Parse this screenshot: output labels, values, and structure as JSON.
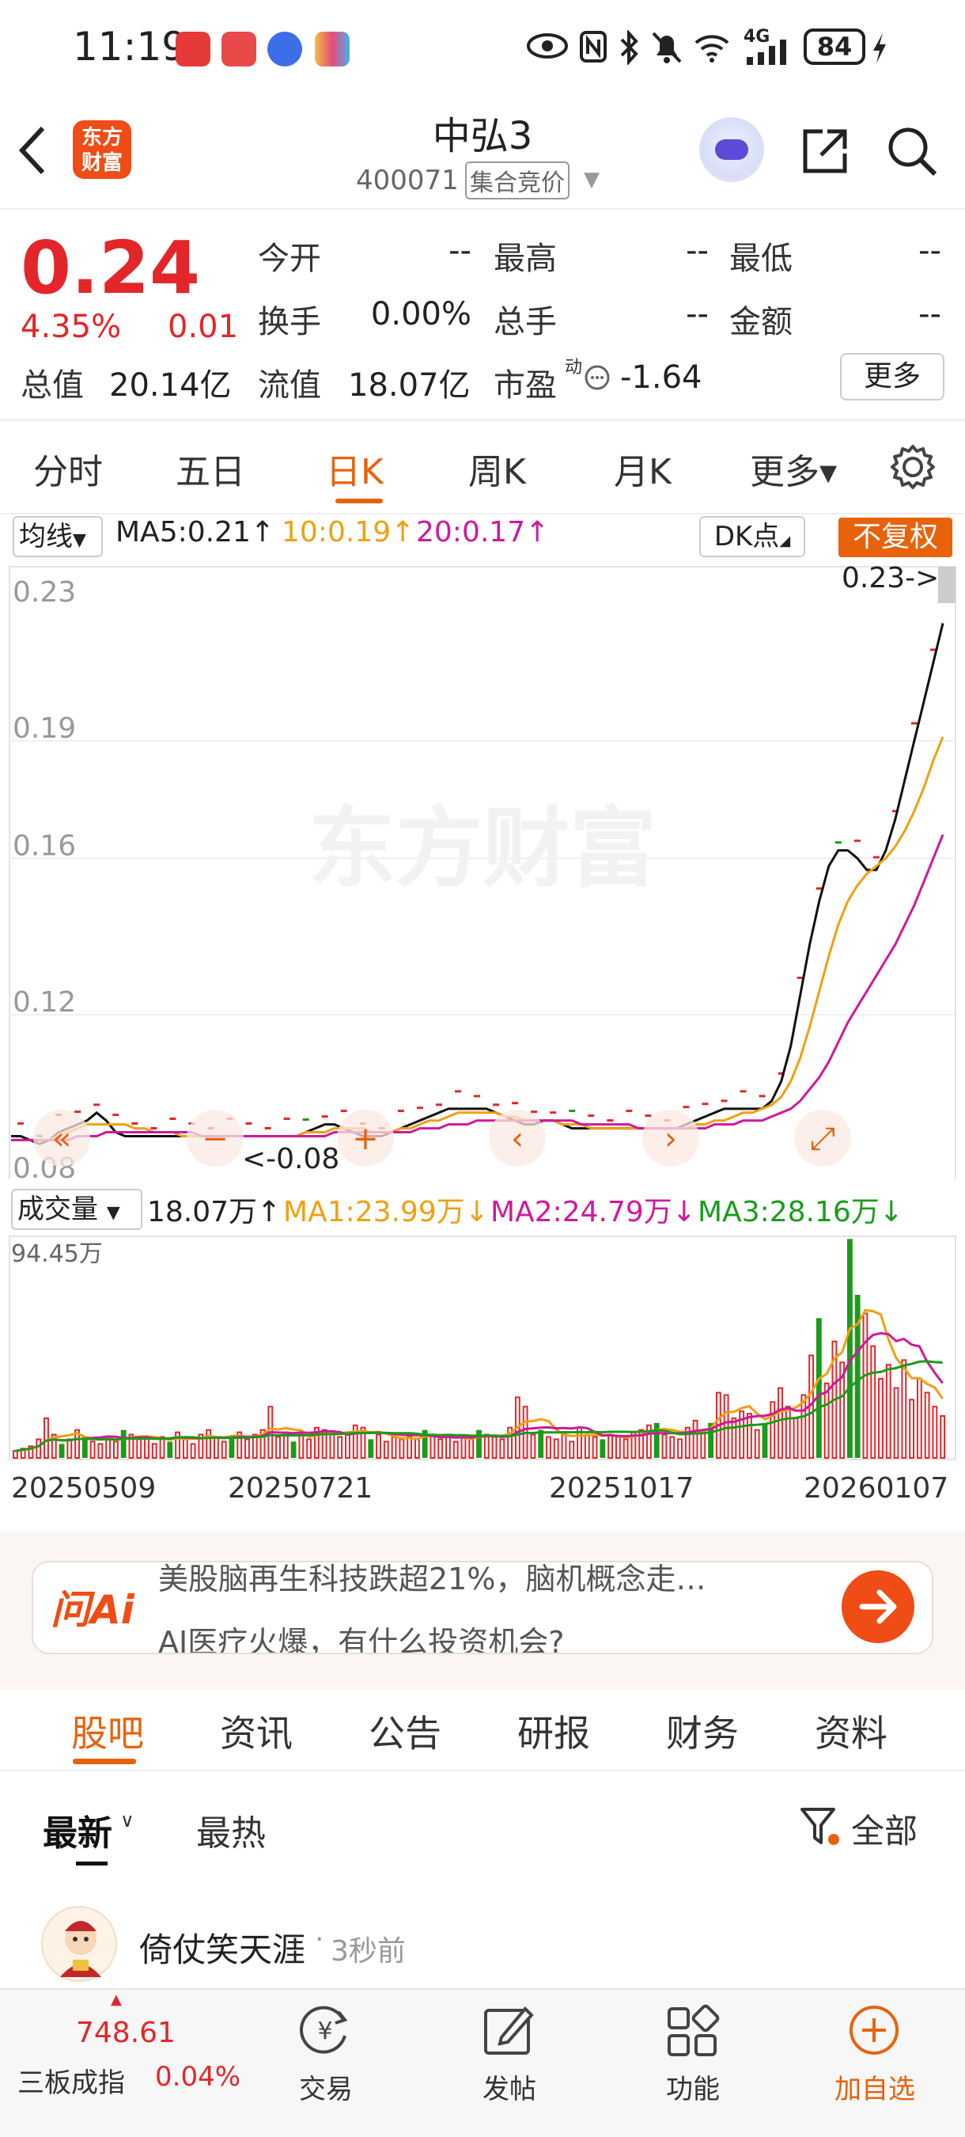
{
  "status_bar": {
    "time": "11:19",
    "network": "4G",
    "battery": "84"
  },
  "header": {
    "back_icon": "chevron-left-icon",
    "logo_text": "东方财富",
    "title": "中弘3",
    "code": "400071",
    "auction_tag": "集合竞价",
    "icons": [
      "robot-assistant-icon",
      "share-icon",
      "search-icon"
    ]
  },
  "quote": {
    "price": "0.24",
    "change_pct": "4.35%",
    "change_abs": "0.01",
    "fields": [
      {
        "label": "今开",
        "value": "--"
      },
      {
        "label": "最高",
        "value": "--"
      },
      {
        "label": "最低",
        "value": "--"
      },
      {
        "label": "换手",
        "value": "0.00%"
      },
      {
        "label": "总手",
        "value": "--"
      },
      {
        "label": "金额",
        "value": "--"
      }
    ],
    "total_value_label": "总值",
    "total_value": "20.14亿",
    "float_value_label": "流值",
    "float_value": "18.07亿",
    "pe_label": "市盈",
    "pe_superscript": "动",
    "pe_value": "-1.64",
    "more_label": "更多",
    "color_up": "#e3262a"
  },
  "period_tabs": [
    "分时",
    "五日",
    "日K",
    "周K",
    "月K",
    "更多▾"
  ],
  "period_active": "日K",
  "ma_legend": {
    "selector": "均线",
    "ma5": "MA5:0.21↑",
    "ma10": "10:0.19↑",
    "ma20": "20:0.17↑",
    "dk_button": "DK点",
    "adjust_button": "不复权",
    "colors": {
      "ma5": "#111111",
      "ma10": "#f0a010",
      "ma20": "#d0189c"
    }
  },
  "chart_data": [
    {
      "type": "line",
      "title": "",
      "y_ticks": [
        "0.23",
        "0.19",
        "0.16",
        "0.12",
        "0.08"
      ],
      "ylim": [
        0.08,
        0.23
      ],
      "watermark": "东方财富",
      "annotations": [
        "0.23->",
        "<-0.08"
      ],
      "series": [
        {
          "name": "MA5",
          "color": "#111111",
          "values": [
            0.089,
            0.089,
            0.088,
            0.087,
            0.088,
            0.09,
            0.091,
            0.092,
            0.093,
            0.095,
            0.093,
            0.09,
            0.089,
            0.089,
            0.089,
            0.089,
            0.089,
            0.089,
            0.089,
            0.089,
            0.089,
            0.089,
            0.089,
            0.089,
            0.089,
            0.089,
            0.089,
            0.089,
            0.089,
            0.089,
            0.089,
            0.09,
            0.091,
            0.092,
            0.092,
            0.091,
            0.09,
            0.089,
            0.089,
            0.089,
            0.09,
            0.091,
            0.092,
            0.093,
            0.094,
            0.095,
            0.096,
            0.096,
            0.096,
            0.096,
            0.096,
            0.095,
            0.094,
            0.093,
            0.092,
            0.092,
            0.093,
            0.093,
            0.092,
            0.091,
            0.091,
            0.091,
            0.091,
            0.091,
            0.091,
            0.091,
            0.091,
            0.091,
            0.091,
            0.091,
            0.091,
            0.092,
            0.093,
            0.094,
            0.095,
            0.096,
            0.096,
            0.096,
            0.096,
            0.096,
            0.098,
            0.103,
            0.112,
            0.125,
            0.138,
            0.149,
            0.158,
            0.162,
            0.162,
            0.16,
            0.157,
            0.157,
            0.162,
            0.17,
            0.18,
            0.19,
            0.2,
            0.21,
            0.22
          ]
        },
        {
          "name": "MA10",
          "color": "#f0a010",
          "values": [
            0.088,
            0.088,
            0.088,
            0.088,
            0.088,
            0.089,
            0.09,
            0.091,
            0.092,
            0.092,
            0.092,
            0.092,
            0.092,
            0.091,
            0.091,
            0.09,
            0.09,
            0.09,
            0.089,
            0.089,
            0.089,
            0.089,
            0.089,
            0.089,
            0.089,
            0.089,
            0.089,
            0.089,
            0.089,
            0.089,
            0.089,
            0.09,
            0.09,
            0.09,
            0.091,
            0.091,
            0.091,
            0.091,
            0.09,
            0.09,
            0.09,
            0.091,
            0.091,
            0.092,
            0.093,
            0.093,
            0.094,
            0.095,
            0.095,
            0.095,
            0.095,
            0.095,
            0.094,
            0.094,
            0.093,
            0.093,
            0.093,
            0.093,
            0.092,
            0.092,
            0.092,
            0.091,
            0.091,
            0.091,
            0.091,
            0.091,
            0.091,
            0.091,
            0.091,
            0.091,
            0.091,
            0.091,
            0.092,
            0.092,
            0.093,
            0.093,
            0.094,
            0.095,
            0.095,
            0.096,
            0.097,
            0.099,
            0.103,
            0.109,
            0.117,
            0.126,
            0.135,
            0.143,
            0.149,
            0.153,
            0.156,
            0.158,
            0.16,
            0.163,
            0.167,
            0.172,
            0.178,
            0.185,
            0.191
          ]
        },
        {
          "name": "MA20",
          "color": "#d0189c",
          "values": [
            0.088,
            0.088,
            0.088,
            0.088,
            0.088,
            0.088,
            0.088,
            0.089,
            0.089,
            0.089,
            0.09,
            0.09,
            0.09,
            0.09,
            0.09,
            0.09,
            0.09,
            0.09,
            0.09,
            0.09,
            0.089,
            0.089,
            0.089,
            0.089,
            0.089,
            0.089,
            0.089,
            0.089,
            0.089,
            0.089,
            0.089,
            0.089,
            0.089,
            0.089,
            0.09,
            0.09,
            0.09,
            0.09,
            0.09,
            0.09,
            0.09,
            0.09,
            0.09,
            0.091,
            0.091,
            0.091,
            0.092,
            0.092,
            0.092,
            0.093,
            0.093,
            0.093,
            0.093,
            0.093,
            0.093,
            0.093,
            0.093,
            0.093,
            0.093,
            0.093,
            0.092,
            0.092,
            0.092,
            0.092,
            0.092,
            0.092,
            0.091,
            0.091,
            0.091,
            0.091,
            0.091,
            0.091,
            0.091,
            0.091,
            0.092,
            0.092,
            0.092,
            0.093,
            0.093,
            0.093,
            0.094,
            0.095,
            0.096,
            0.098,
            0.101,
            0.104,
            0.108,
            0.113,
            0.118,
            0.122,
            0.126,
            0.13,
            0.134,
            0.138,
            0.143,
            0.148,
            0.154,
            0.16,
            0.166
          ]
        }
      ]
    },
    {
      "type": "bar",
      "title": "",
      "ymax_label": "94.45万",
      "x_ticks": [
        "20250509",
        "20250721",
        "20251017",
        "20260107"
      ],
      "ylim": [
        0,
        94.45
      ],
      "unit": "万",
      "values": [
        3,
        4,
        5,
        8,
        17,
        10,
        6,
        8,
        12,
        9,
        7,
        6,
        9,
        7,
        12,
        10,
        8,
        9,
        6,
        9,
        7,
        11,
        8,
        6,
        10,
        12,
        9,
        7,
        9,
        11,
        8,
        10,
        12,
        22,
        9,
        11,
        7,
        10,
        8,
        13,
        12,
        10,
        9,
        11,
        14,
        13,
        8,
        10,
        7,
        9,
        8,
        9,
        8,
        12,
        10,
        8,
        9,
        7,
        9,
        8,
        12,
        10,
        9,
        8,
        13,
        26,
        22,
        10,
        12,
        9,
        8,
        11,
        7,
        13,
        10,
        9,
        8,
        10,
        9,
        8,
        11,
        12,
        14,
        15,
        10,
        9,
        8,
        13,
        16,
        12,
        15,
        28,
        27,
        17,
        20,
        19,
        12,
        15,
        24,
        30,
        22,
        17,
        27,
        44,
        60,
        32,
        50,
        41,
        94,
        70,
        62,
        48,
        34,
        40,
        30,
        42,
        25,
        34,
        28,
        22,
        18
      ],
      "down_days": [
        6,
        9,
        14,
        20,
        28,
        36,
        46,
        53,
        60,
        68,
        76,
        83,
        90,
        97,
        104,
        108,
        109
      ],
      "series": [
        {
          "name": "MA1",
          "label": "MA1:23.99万↓",
          "color": "#f0a010"
        },
        {
          "name": "MA2",
          "label": "MA2:24.79万↓",
          "color": "#d0189c"
        },
        {
          "name": "MA3",
          "label": "MA3:28.16万↓",
          "color": "#1a9c1a"
        }
      ]
    }
  ],
  "volume_legend": {
    "selector": "成交量",
    "current": "18.07万↑"
  },
  "ai": {
    "logo": "问Ai",
    "line1": "美股脑再生科技跌超21%，脑机概念走…",
    "line2": "AI医疗火爆，有什么投资机会?",
    "go_icon": "arrow-right-icon"
  },
  "section_tabs": [
    "股吧",
    "资讯",
    "公告",
    "研报",
    "财务",
    "资料"
  ],
  "section_active": "股吧",
  "sub_tabs": [
    "最新",
    "最热"
  ],
  "filter_label": "全部",
  "post": {
    "author": "倚仗笑天涯",
    "time": "3秒前"
  },
  "bottom_bar": {
    "index_value": "748.61",
    "index_name": "三板成指",
    "index_change": "0.04%",
    "items": [
      "交易",
      "发帖",
      "功能",
      "加自选"
    ]
  }
}
